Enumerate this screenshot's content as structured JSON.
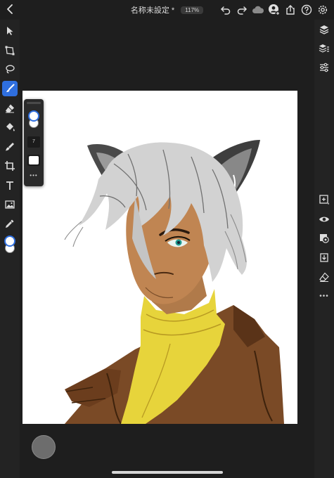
{
  "document": {
    "title": "名称未設定 *",
    "zoom": "117%"
  },
  "brush_panel": {
    "size_value": "7",
    "more_label": "•••"
  },
  "right_rail": {
    "more_label": "•••"
  },
  "colors": {
    "canvas": "#ffffff",
    "accent": "#2f6fdf",
    "chrome": "#1e1e1e",
    "rail": "#232323",
    "active_color": "#ffffff"
  },
  "icons": {
    "top_left": [
      "back-chevron-icon"
    ],
    "top_right": [
      "undo-icon",
      "redo-icon",
      "cloud-icon",
      "user-add-icon",
      "share-icon",
      "help-icon",
      "settings-icon"
    ],
    "left_tools": [
      "select-arrow-icon",
      "transform-icon",
      "lasso-icon",
      "brush-icon",
      "eraser-icon",
      "fill-bucket-icon",
      "smudge-icon",
      "crop-icon",
      "text-icon",
      "image-icon",
      "eyedropper-icon",
      "color-swatch-icon"
    ],
    "right_tools": [
      "layers-icon",
      "layer-properties-icon",
      "adjustments-icon",
      "add-layer-icon",
      "visibility-icon",
      "mask-icon",
      "merge-down-icon",
      "clear-layer-icon",
      "more-icon"
    ]
  }
}
